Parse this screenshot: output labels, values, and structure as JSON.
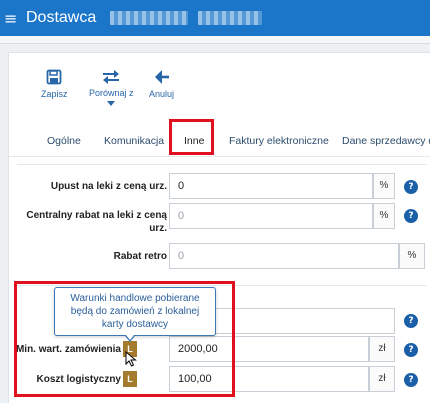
{
  "header": {
    "menu_icon": "hamburger-icon",
    "title": "Dostawca"
  },
  "toolbar": {
    "save_label": "Zapisz",
    "compare_label": "Porównaj z",
    "cancel_label": "Anuluj"
  },
  "tabs": [
    {
      "label": "Ogólne"
    },
    {
      "label": "Komunikacja"
    },
    {
      "label": "Inne",
      "active": true
    },
    {
      "label": "Faktury elektroniczne"
    },
    {
      "label": "Dane sprzedawcy dla"
    }
  ],
  "form": {
    "upust": {
      "label": "Upust na leki z ceną urz.",
      "value": "0",
      "unit": "%"
    },
    "centralny": {
      "label": "Centralny rabat na leki z ceną urz.",
      "placeholder": "0",
      "unit": "%"
    },
    "retro": {
      "label": "Rabat retro",
      "placeholder": "0",
      "unit": "%"
    },
    "min_wart": {
      "label": "Min. wart. zamówienia",
      "badge": "L",
      "value": "2000,00",
      "unit": "zł"
    },
    "koszt": {
      "label": "Koszt logistyczny",
      "badge": "L",
      "value": "100,00",
      "unit": "zł"
    }
  },
  "tooltip": {
    "text": "Warunki handlowe pobierane będą do zamówień z lokalnej karty dostawcy"
  },
  "colors": {
    "topbar": "#1b75c9",
    "highlight": "#e0101f",
    "badge": "#a47b2c",
    "help": "#1a5fa8"
  }
}
